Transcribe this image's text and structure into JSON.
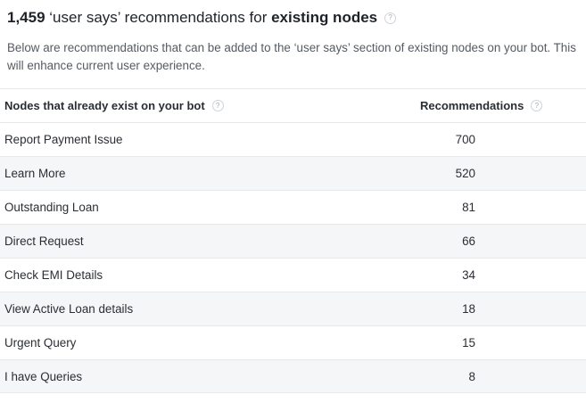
{
  "heading": {
    "count": "1,459",
    "middle": "‘user says’ recommendations for",
    "emphasis": "existing nodes",
    "help": "?"
  },
  "description": "Below are recommendations that can be added to the ‘user says’ section of existing nodes on your bot. This will enhance current user experience.",
  "table": {
    "columns": {
      "node": "Nodes that already exist on your bot",
      "recommendations": "Recommendations",
      "help": "?"
    },
    "rows": [
      {
        "node": "Report Payment Issue",
        "value": "700"
      },
      {
        "node": "Learn More",
        "value": "520"
      },
      {
        "node": "Outstanding Loan",
        "value": "81"
      },
      {
        "node": "Direct Request",
        "value": "66"
      },
      {
        "node": "Check EMI Details",
        "value": "34"
      },
      {
        "node": "View Active Loan details",
        "value": "18"
      },
      {
        "node": "Urgent Query",
        "value": "15"
      },
      {
        "node": "I have Queries",
        "value": "8"
      }
    ]
  }
}
